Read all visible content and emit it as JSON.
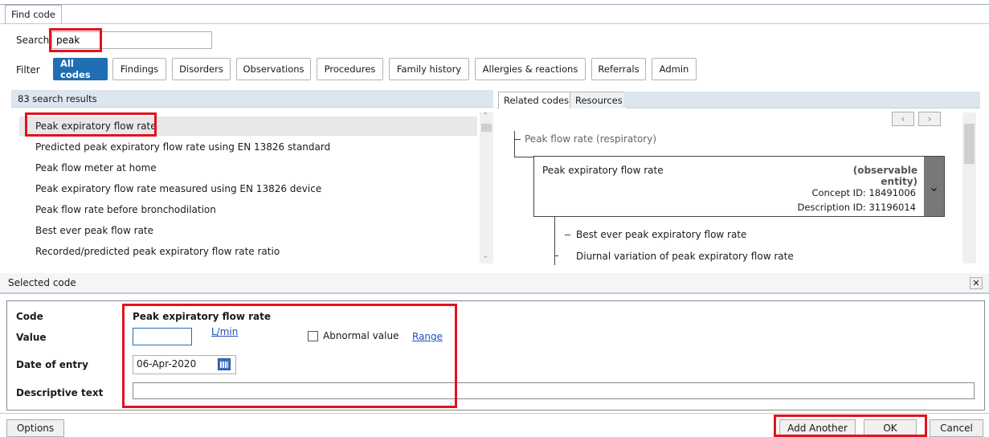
{
  "window": {
    "tab": "Find code"
  },
  "search": {
    "label": "Search",
    "value": "peak"
  },
  "filter": {
    "label": "Filter",
    "buttons": [
      "All codes",
      "Findings",
      "Disorders",
      "Observations",
      "Procedures",
      "Family history",
      "Allergies & reactions",
      "Referrals",
      "Admin"
    ],
    "active": "All codes"
  },
  "results": {
    "header": "83 search results",
    "items": [
      "Peak expiratory flow rate",
      "Predicted peak expiratory flow rate using EN 13826 standard",
      "Peak flow meter at home",
      "Peak expiratory flow rate measured using EN 13826 device",
      "Peak flow rate before bronchodilation",
      "Best ever peak flow rate",
      "Recorded/predicted peak expiratory flow rate ratio"
    ]
  },
  "related": {
    "tabs": [
      "Related codes",
      "Resources"
    ],
    "parent": "Peak flow rate (respiratory)",
    "current": {
      "name": "Peak expiratory flow rate",
      "type": "(observable entity)",
      "concept_id": "Concept ID: 18491006",
      "description_id": "Description ID: 31196014"
    },
    "children": [
      "Best ever peak expiratory flow rate",
      "Diurnal variation of peak expiratory flow rate"
    ]
  },
  "selected": {
    "title": "Selected code",
    "code_label": "Code",
    "code_value": "Peak expiratory flow rate",
    "value_label": "Value",
    "value_input": "",
    "unit": "L/min",
    "abnormal_label": "Abnormal value",
    "range_label": "Range",
    "date_label": "Date of entry",
    "date_value": "06-Apr-2020",
    "desc_label": "Descriptive text",
    "desc_value": ""
  },
  "footer": {
    "options": "Options",
    "add_another": "Add Another",
    "ok": "OK",
    "cancel": "Cancel"
  }
}
